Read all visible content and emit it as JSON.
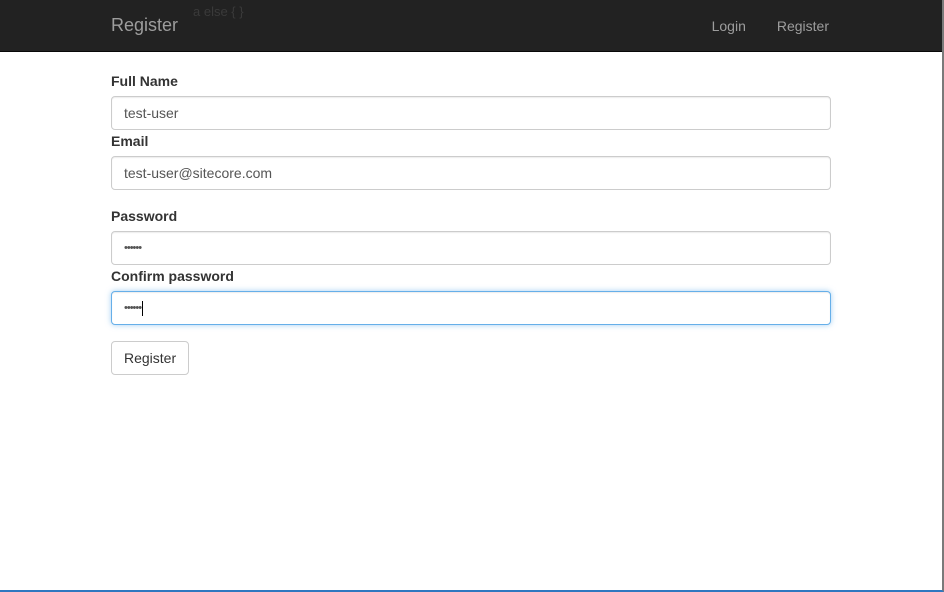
{
  "navbar": {
    "brand": "Register",
    "overlay_text": "a else { }",
    "links": [
      {
        "label": "Login"
      },
      {
        "label": "Register"
      }
    ]
  },
  "form": {
    "full_name": {
      "label": "Full Name",
      "value": "test-user"
    },
    "email": {
      "label": "Email",
      "value": "test-user@sitecore.com"
    },
    "password": {
      "label": "Password",
      "value": "••••••"
    },
    "confirm_password": {
      "label": "Confirm password",
      "value": "••••••"
    },
    "submit_label": "Register"
  },
  "colors": {
    "navbar_bg": "#222222",
    "nav_text": "#9d9d9d",
    "focus_border": "#66afe9"
  }
}
